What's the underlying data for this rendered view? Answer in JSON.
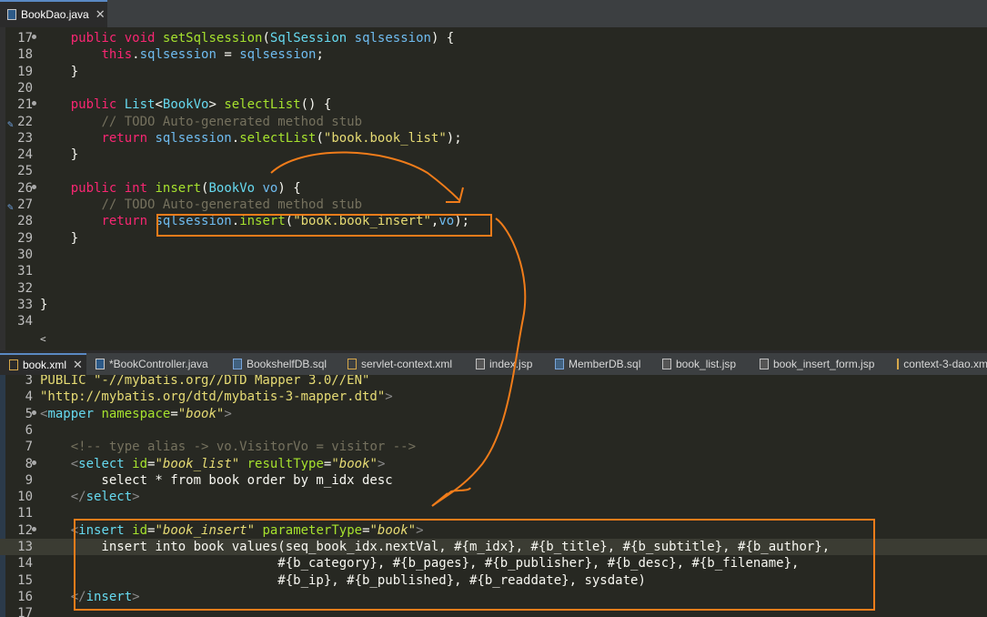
{
  "top_tab": {
    "label": "BookDao.java",
    "close": "✕"
  },
  "java_lines": [
    {
      "n": "17",
      "fold": true,
      "tokens": [
        [
          "",
          "    "
        ],
        [
          "kw",
          "public"
        ],
        [
          "",
          " "
        ],
        [
          "kw",
          "void"
        ],
        [
          "",
          " "
        ],
        [
          "fn",
          "setSqlsession"
        ],
        [
          "",
          "("
        ],
        [
          "type",
          "SqlSession"
        ],
        [
          "",
          " "
        ],
        [
          "var",
          "sqlsession"
        ],
        [
          "",
          ") {"
        ]
      ]
    },
    {
      "n": "18",
      "tokens": [
        [
          "",
          "        "
        ],
        [
          "kw",
          "this"
        ],
        [
          "",
          "."
        ],
        [
          "var",
          "sqlsession"
        ],
        [
          "",
          " = "
        ],
        [
          "var",
          "sqlsession"
        ],
        [
          "",
          ";"
        ]
      ]
    },
    {
      "n": "19",
      "tokens": [
        [
          "",
          "    }"
        ]
      ]
    },
    {
      "n": "20",
      "tokens": [
        [
          "",
          ""
        ]
      ]
    },
    {
      "n": "21",
      "fold": true,
      "tokens": [
        [
          "",
          "    "
        ],
        [
          "kw",
          "public"
        ],
        [
          "",
          " "
        ],
        [
          "type",
          "List"
        ],
        [
          "",
          "<"
        ],
        [
          "type",
          "BookVo"
        ],
        [
          "",
          "> "
        ],
        [
          "fn",
          "selectList"
        ],
        [
          "",
          "() {"
        ]
      ]
    },
    {
      "n": "22",
      "annot": true,
      "tokens": [
        [
          "",
          "        "
        ],
        [
          "cm",
          "// TODO Auto-generated method stub"
        ]
      ]
    },
    {
      "n": "23",
      "tokens": [
        [
          "",
          "        "
        ],
        [
          "kw",
          "return"
        ],
        [
          "",
          " "
        ],
        [
          "var",
          "sqlsession"
        ],
        [
          "",
          "."
        ],
        [
          "fn",
          "selectList"
        ],
        [
          "",
          "("
        ],
        [
          "str",
          "\"book.book_list\""
        ],
        [
          "",
          ");"
        ]
      ]
    },
    {
      "n": "24",
      "tokens": [
        [
          "",
          "    }"
        ]
      ]
    },
    {
      "n": "25",
      "tokens": [
        [
          "",
          ""
        ]
      ]
    },
    {
      "n": "26",
      "fold": true,
      "tokens": [
        [
          "",
          "    "
        ],
        [
          "kw",
          "public"
        ],
        [
          "",
          " "
        ],
        [
          "kw",
          "int"
        ],
        [
          "",
          " "
        ],
        [
          "fn",
          "insert"
        ],
        [
          "",
          "("
        ],
        [
          "type",
          "BookVo"
        ],
        [
          "",
          " "
        ],
        [
          "var",
          "vo"
        ],
        [
          "",
          ") {"
        ]
      ]
    },
    {
      "n": "27",
      "annot": true,
      "tokens": [
        [
          "",
          "        "
        ],
        [
          "cm",
          "// TODO Auto-generated method stub"
        ]
      ]
    },
    {
      "n": "28",
      "tokens": [
        [
          "",
          "        "
        ],
        [
          "kw",
          "return"
        ],
        [
          "",
          " "
        ],
        [
          "var",
          "sqlsession"
        ],
        [
          "",
          "."
        ],
        [
          "fn",
          "insert"
        ],
        [
          "",
          "("
        ],
        [
          "str",
          "\"book.book_insert\""
        ],
        [
          "",
          ","
        ],
        [
          "var",
          "vo"
        ],
        [
          "",
          ");"
        ]
      ]
    },
    {
      "n": "29",
      "tokens": [
        [
          "",
          "    }"
        ]
      ]
    },
    {
      "n": "30",
      "tokens": [
        [
          "",
          ""
        ]
      ]
    },
    {
      "n": "31",
      "tokens": [
        [
          "",
          ""
        ]
      ]
    },
    {
      "n": "32",
      "tokens": [
        [
          "",
          ""
        ]
      ]
    },
    {
      "n": "33",
      "tokens": [
        [
          "",
          "}"
        ]
      ]
    },
    {
      "n": "34",
      "tokens": [
        [
          "",
          ""
        ]
      ]
    }
  ],
  "scroll_mark": "<",
  "bottom_tabs": [
    {
      "label": "book.xml",
      "icon": "xml",
      "active": true,
      "close": "✕"
    },
    {
      "label": "*BookController.java",
      "icon": "java"
    },
    {
      "label": "BookshelfDB.sql",
      "icon": "sql"
    },
    {
      "label": "servlet-context.xml",
      "icon": "xml"
    },
    {
      "label": "index.jsp",
      "icon": "jsp"
    },
    {
      "label": "MemberDB.sql",
      "icon": "sql"
    },
    {
      "label": "book_list.jsp",
      "icon": "jsp"
    },
    {
      "label": "book_insert_form.jsp",
      "icon": "jsp"
    },
    {
      "label": "context-3-dao.xm",
      "icon": "xml"
    }
  ],
  "xml_lines": [
    {
      "n": "3",
      "tokens": [
        [
          "str",
          "PUBLIC \"-//mybatis.org//DTD Mapper 3.0//EN\""
        ]
      ]
    },
    {
      "n": "4",
      "tokens": [
        [
          "str",
          "\"http://mybatis.org/dtd/mybatis-3-mapper.dtd\""
        ],
        [
          "brk",
          ">"
        ]
      ]
    },
    {
      "n": "5",
      "fold": true,
      "tokens": [
        [
          "brk",
          "<"
        ],
        [
          "tag",
          "mapper"
        ],
        [
          "",
          " "
        ],
        [
          "attr",
          "namespace"
        ],
        [
          "",
          "="
        ],
        [
          "aval",
          "\"book\""
        ],
        [
          "brk",
          ">"
        ]
      ]
    },
    {
      "n": "6",
      "tokens": [
        [
          "",
          ""
        ]
      ]
    },
    {
      "n": "7",
      "tokens": [
        [
          "",
          "    "
        ],
        [
          "cm",
          "<!-- type alias -> vo.VisitorVo = visitor -->"
        ]
      ]
    },
    {
      "n": "8",
      "fold": true,
      "tokens": [
        [
          "",
          "    "
        ],
        [
          "brk",
          "<"
        ],
        [
          "tag",
          "select"
        ],
        [
          "",
          " "
        ],
        [
          "attr",
          "id"
        ],
        [
          "",
          "="
        ],
        [
          "aval",
          "\"book_list\""
        ],
        [
          "",
          " "
        ],
        [
          "attr",
          "resultType"
        ],
        [
          "",
          "="
        ],
        [
          "aval",
          "\"book\""
        ],
        [
          "brk",
          ">"
        ]
      ]
    },
    {
      "n": "9",
      "tokens": [
        [
          "",
          "        select * from book order by m_idx desc"
        ]
      ]
    },
    {
      "n": "10",
      "tokens": [
        [
          "",
          "    "
        ],
        [
          "brk",
          "</"
        ],
        [
          "tag",
          "select"
        ],
        [
          "brk",
          ">"
        ]
      ]
    },
    {
      "n": "11",
      "tokens": [
        [
          "",
          ""
        ]
      ]
    },
    {
      "n": "12",
      "fold": true,
      "tokens": [
        [
          "",
          "    "
        ],
        [
          "brk",
          "<"
        ],
        [
          "tag",
          "insert"
        ],
        [
          "",
          " "
        ],
        [
          "attr",
          "id"
        ],
        [
          "",
          "="
        ],
        [
          "aval",
          "\"book_insert\""
        ],
        [
          "",
          " "
        ],
        [
          "attr",
          "parameterType"
        ],
        [
          "",
          "="
        ],
        [
          "aval",
          "\"book\""
        ],
        [
          "brk",
          ">"
        ]
      ]
    },
    {
      "n": "13",
      "current": true,
      "tokens": [
        [
          "",
          "        insert into book values(seq_book_idx.nextVal, #{m_idx}, #{b_title}, #{b_subtitle}, #{b_author},"
        ]
      ]
    },
    {
      "n": "14",
      "tokens": [
        [
          "",
          "                               #{b_category}, #{b_pages}, #{b_publisher}, #{b_desc}, #{b_filename},"
        ]
      ]
    },
    {
      "n": "15",
      "tokens": [
        [
          "",
          "                               #{b_ip}, #{b_published}, #{b_readdate}, sysdate)"
        ]
      ]
    },
    {
      "n": "16",
      "tokens": [
        [
          "",
          "    "
        ],
        [
          "brk",
          "</"
        ],
        [
          "tag",
          "insert"
        ],
        [
          "brk",
          ">"
        ]
      ]
    },
    {
      "n": "17",
      "tokens": [
        [
          "",
          ""
        ]
      ]
    }
  ],
  "colors": {
    "highlight_box": "#f07c1a",
    "arrow": "#f07c1a"
  }
}
